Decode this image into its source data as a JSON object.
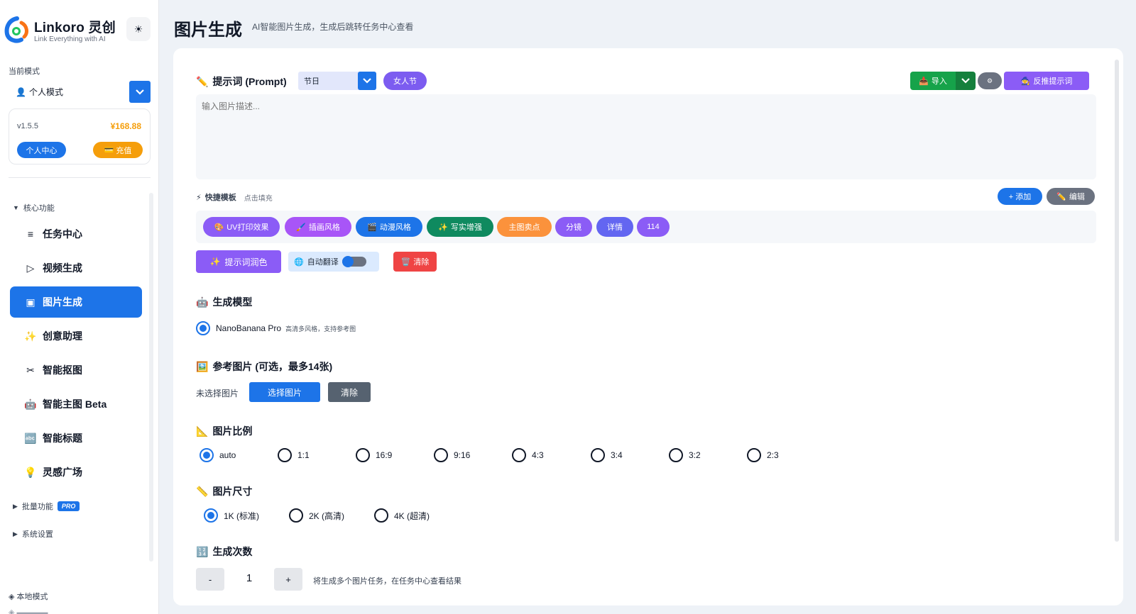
{
  "app": {
    "logo_name": "Linkoro 灵创",
    "logo_tagline": "Link Everything with AI",
    "theme_icon": "sun-icon"
  },
  "sidebar": {
    "mode_label": "当前模式",
    "mode_value": "个人模式",
    "version": "v1.5.5",
    "balance": "¥168.88",
    "profile_button": "个人中心",
    "recharge_button": "充值",
    "core_group": "核心功能",
    "items": [
      {
        "label": "任务中心",
        "icon": "list-icon"
      },
      {
        "label": "视频生成",
        "icon": "play-icon"
      },
      {
        "label": "图片生成",
        "icon": "image-icon",
        "active": true
      },
      {
        "label": "创意助理",
        "icon": "sparkles-icon"
      },
      {
        "label": "智能抠图",
        "icon": "scissors-icon"
      },
      {
        "label": "智能主图 Beta",
        "icon": "robot-icon"
      },
      {
        "label": "智能标题",
        "icon": "abc-icon"
      },
      {
        "label": "灵感广场",
        "icon": "bulb-icon"
      }
    ],
    "batch_group": "批量功能",
    "pro_badge": "PRO",
    "settings_group": "系统设置",
    "local_mode": "本地模式"
  },
  "header": {
    "title": "图片生成",
    "subtitle": "AI智能图片生成，生成后跳转任务中心查看"
  },
  "prompt": {
    "title": "提示词 (Prompt)",
    "preset_value": "节日",
    "tag": "女人节",
    "import_label": "导入",
    "gear_label": "⚙",
    "reverse_label": "反推提示词",
    "placeholder": "输入图片描述..."
  },
  "templates": {
    "title": "快捷模板",
    "hint": "点击填充",
    "add_label": "+ 添加",
    "edit_label": "编辑",
    "chips": [
      {
        "label": "UV打印效果",
        "emoji": "🎨",
        "color": "#8b5cf6"
      },
      {
        "label": "插画风格",
        "emoji": "🖌️",
        "color": "#a855f7"
      },
      {
        "label": "动漫风格",
        "emoji": "🎬",
        "color": "#1d74e8"
      },
      {
        "label": "写实增强",
        "emoji": "✨",
        "color": "#0f8a5f"
      },
      {
        "label": "主图卖点",
        "emoji": "",
        "color": "#fb923c"
      },
      {
        "label": "分镜",
        "emoji": "",
        "color": "#8b5cf6"
      },
      {
        "label": "详情",
        "emoji": "",
        "color": "#6366f1"
      },
      {
        "label": "114",
        "emoji": "",
        "color": "#8b5cf6"
      }
    ]
  },
  "actions": {
    "polish_label": "提示词润色",
    "translate_label": "自动翻译",
    "translate_on": true,
    "clear_label": "清除"
  },
  "model": {
    "title": "生成模型",
    "name": "NanoBanana Pro",
    "desc": "高清多风格，支持参考图"
  },
  "reference": {
    "title": "参考图片 (可选，最多14张)",
    "status": "未选择图片",
    "choose_label": "选择图片",
    "clear_label": "清除"
  },
  "ratio": {
    "title": "图片比例",
    "selected": "auto",
    "options": [
      "auto",
      "1:1",
      "16:9",
      "9:16",
      "4:3",
      "3:4",
      "3:2",
      "2:3"
    ]
  },
  "size": {
    "title": "图片尺寸",
    "selected": "1K (标准)",
    "options": [
      "1K (标准)",
      "2K (高清)",
      "4K (超清)"
    ]
  },
  "count": {
    "title": "生成次数",
    "minus": "-",
    "value": "1",
    "plus": "+",
    "note": "将生成多个图片任务，在任务中心查看结果"
  },
  "colors": {
    "primary": "#1d74e8",
    "purple": "#8b5cf6",
    "green": "#16a34a",
    "orange": "#f59e0b",
    "red": "#ef4444"
  }
}
